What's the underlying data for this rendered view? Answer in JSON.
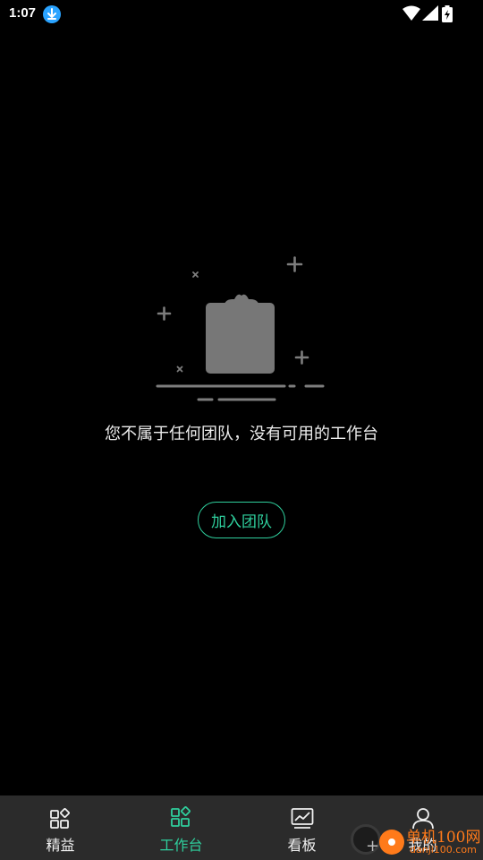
{
  "status_bar": {
    "time": "1:07",
    "download_icon": "download-arrow-icon",
    "wifi_icon": "wifi-icon",
    "signal_icon": "cell-signal-icon",
    "battery_icon": "battery-charging-icon"
  },
  "empty_state": {
    "illustration": "clipboard-empty-icon",
    "message": "您不属于任何团队，没有可用的工作台",
    "join_button_label": "加入团队"
  },
  "bottom_nav": {
    "items": [
      {
        "label": "精益",
        "icon": "grid-apps-icon",
        "active": false
      },
      {
        "label": "工作台",
        "icon": "workbench-grid-icon",
        "active": true
      },
      {
        "label": "看板",
        "icon": "chart-board-icon",
        "active": false
      },
      {
        "label": "我的",
        "icon": "person-icon",
        "active": false
      }
    ]
  },
  "watermark": {
    "text": "单机100网",
    "sub": "danji100.com"
  },
  "colors": {
    "accent": "#2fcf9d",
    "background": "#000000",
    "nav_background": "#2b2b2b",
    "watermark": "#ff7a1a"
  }
}
